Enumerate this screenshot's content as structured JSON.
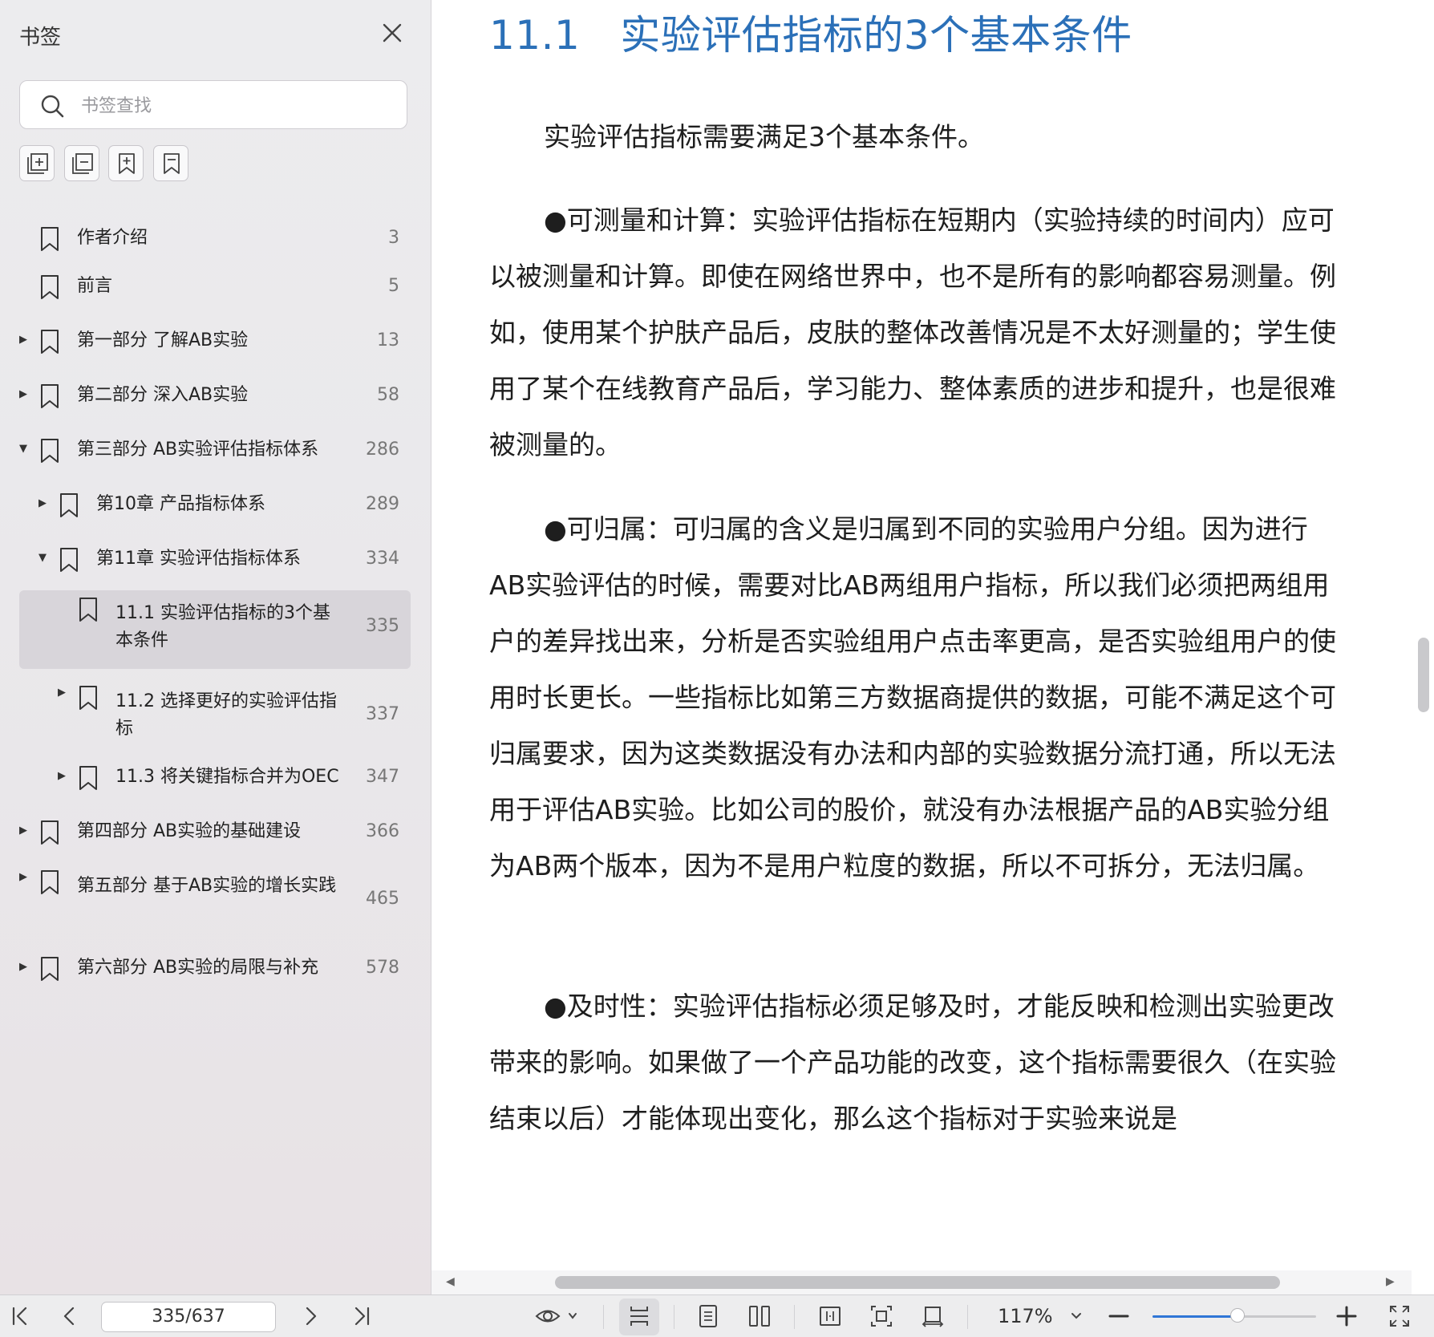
{
  "sidebar": {
    "title": "书签",
    "search_placeholder": "书签查找",
    "tools": [
      "expand-all-icon",
      "collapse-all-icon",
      "add-bookmark-icon",
      "bookmark-page-icon"
    ],
    "items": [
      {
        "label": "作者介绍",
        "page": "3",
        "arrow": ""
      },
      {
        "label": "前言",
        "page": "5",
        "arrow": ""
      },
      {
        "label": "第一部分 了解AB实验",
        "page": "13",
        "arrow": "▶"
      },
      {
        "label": "第二部分 深入AB实验",
        "page": "58",
        "arrow": "▶"
      },
      {
        "label": "第三部分 AB实验评估指标体系",
        "page": "286",
        "arrow": "▼"
      },
      {
        "label": "第10章 产品指标体系",
        "page": "289",
        "arrow": "▶"
      },
      {
        "label": "第11章 实验评估指标体系",
        "page": "334",
        "arrow": "▼"
      },
      {
        "label": "11.1 实验评估指标的3个基本条件",
        "page": "335",
        "arrow": ""
      },
      {
        "label": "11.2 选择更好的实验评估指标",
        "page": "337",
        "arrow": "▶"
      },
      {
        "label": "11.3 将关键指标合并为OEC",
        "page": "347",
        "arrow": "▶"
      },
      {
        "label": "第四部分 AB实验的基础建设",
        "page": "366",
        "arrow": "▶"
      },
      {
        "label": "第五部分 基于AB实验的增长实践",
        "page": "465",
        "arrow": "▶"
      },
      {
        "label": "第六部分 AB实验的局限与补充",
        "page": "578",
        "arrow": "▶"
      }
    ]
  },
  "document": {
    "heading_number": "11.1",
    "heading_text": "实验评估指标的3个基本条件",
    "intro": "实验评估指标需要满足3个基本条件。",
    "bullets": [
      "●可测量和计算：实验评估指标在短期内（实验持续的时间内）应可以被测量和计算。即使在网络世界中，也不是所有的影响都容易测量。例如，使用某个护肤产品后，皮肤的整体改善情况是不太好测量的；学生使用了某个在线教育产品后，学习能力、整体素质的进步和提升，也是很难被测量的。",
      "●可归属：可归属的含义是归属到不同的实验用户分组。因为进行AB实验评估的时候，需要对比AB两组用户指标，所以我们必须把两组用户的差异找出来，分析是否实验组用户点击率更高，是否实验组用户的使用时长更长。一些指标比如第三方数据商提供的数据，可能不满足这个可归属要求，因为这类数据没有办法和内部的实验数据分流打通，所以无法用于评估AB实验。比如公司的股价，就没有办法根据产品的AB实验分组为AB两个版本，因为不是用户粒度的数据，所以不可拆分，无法归属。",
      "●及时性：实验评估指标必须足够及时，才能反映和检测出实验更改带来的影响。如果做了一个产品功能的改变，这个指标需要很久（在实验结束以后）才能体现出变化，那么这个指标对于实验来说是"
    ]
  },
  "toolbar": {
    "page_indicator": "335/637",
    "zoom": "117%",
    "zoom_level": 0.52
  },
  "colors": {
    "heading": "#2b70b8",
    "zoom_accent": "#2f76d6",
    "selected_bookmark_bg": "#d8d5da"
  }
}
